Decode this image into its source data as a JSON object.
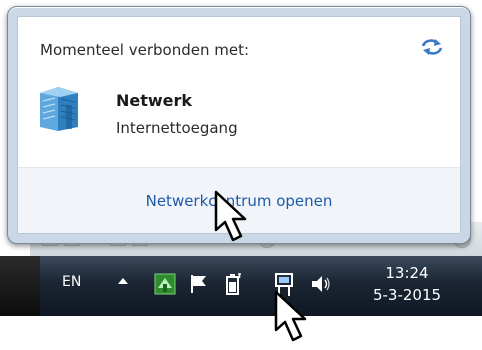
{
  "popup": {
    "header": "Momenteel verbonden met:",
    "network": {
      "name": "Netwerk",
      "access": "Internettoegang"
    },
    "footer_link": "Netwerkcentrum openen"
  },
  "taskbar": {
    "language": "EN",
    "clock": {
      "time": "13:24",
      "date": "5-3-2015"
    }
  },
  "icons": {
    "refresh": "refresh-arrows-icon",
    "network": "network-building-icon",
    "tray_expand": "show-hidden-icons-arrow",
    "app_tray": "green-app-icon",
    "action_center": "flag-icon",
    "power": "battery-plug-icon",
    "network_tray": "network-wired-icon",
    "volume": "speaker-icon"
  },
  "colors": {
    "link": "#1e5aa8",
    "popup_frame": "#c9d7e6",
    "taskbar": "#1b2533"
  }
}
